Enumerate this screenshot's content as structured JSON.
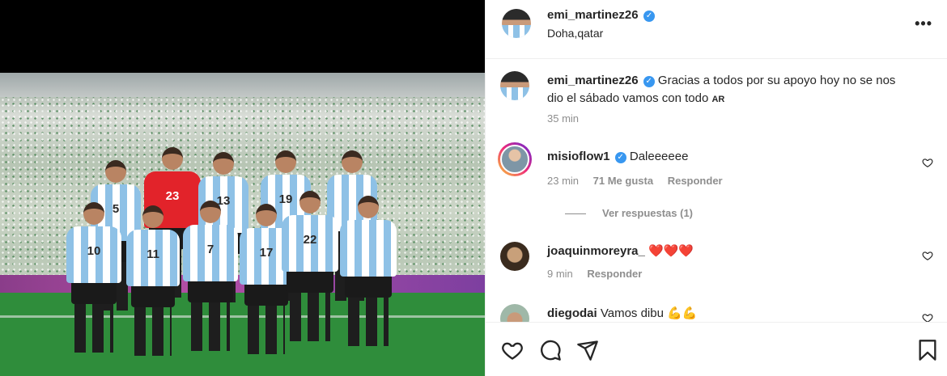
{
  "post": {
    "author": "emi_martinez26",
    "location": "Doha,qatar",
    "caption": "Gracias a todos por su apoyo hoy no se nos dio el sábado vamos con todo",
    "caption_flag": "AR",
    "caption_time": "35 min"
  },
  "photo": {
    "jersey_numbers": [
      "23",
      "13",
      "19",
      "10",
      "11",
      "7",
      "17",
      "22",
      "5"
    ]
  },
  "comments": [
    {
      "user": "misioflow1",
      "verified": true,
      "text": "Daleeeeee",
      "time": "23 min",
      "likes": "71 Me gusta",
      "reply": "Responder",
      "view_replies": "Ver respuestas (1)"
    },
    {
      "user": "joaquinmoreyra_",
      "text": "❤️❤️❤️",
      "time": "9 min",
      "reply": "Responder"
    },
    {
      "user": "diegodai",
      "text": "Vamos dibu",
      "emoji": "💪💪"
    }
  ],
  "icons": {
    "more": "more-options-icon",
    "like": "heart-icon",
    "comment": "comment-icon",
    "share": "share-icon",
    "save": "bookmark-icon"
  },
  "colors": {
    "verified": "#3897f0",
    "heart_red": "#e0245e",
    "muted_text": "#8e8e8e"
  }
}
